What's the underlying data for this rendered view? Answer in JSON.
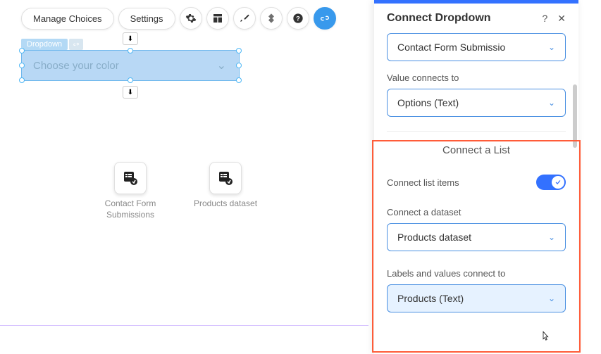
{
  "toolbar": {
    "manage_choices": "Manage Choices",
    "settings": "Settings"
  },
  "canvas": {
    "element_tag": "Dropdown",
    "placeholder": "Choose your color"
  },
  "datasets": [
    {
      "label": "Contact Form Submissions"
    },
    {
      "label": "Products dataset"
    }
  ],
  "panel": {
    "title": "Connect Dropdown",
    "dataset_select": "Contact Form Submissio",
    "value_label": "Value connects to",
    "value_select": "Options (Text)",
    "section_header": "Connect a List",
    "list_toggle_label": "Connect list items",
    "dataset_label": "Connect a dataset",
    "dataset_select2": "Products dataset",
    "labels_values_label": "Labels and values connect to",
    "labels_values_select": "Products (Text)"
  }
}
